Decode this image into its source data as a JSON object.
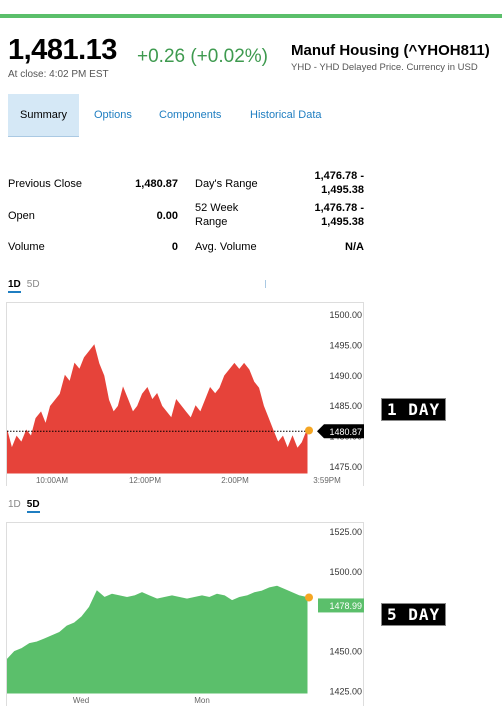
{
  "header": {
    "price": "1,481.13",
    "change": "+0.26 (+0.02%)",
    "close_time": "At close: 4:02 PM EST",
    "name": "Manuf Housing (^YHOH811)",
    "sub": "YHD - YHD Delayed Price. Currency in USD"
  },
  "tabs": [
    "Summary",
    "Options",
    "Components",
    "Historical Data"
  ],
  "stats": {
    "prev_close_label": "Previous Close",
    "prev_close_value": "1,480.87",
    "open_label": "Open",
    "open_value": "0.00",
    "volume_label": "Volume",
    "volume_value": "0",
    "days_range_label": "Day's Range",
    "days_range_value_1": "1,476.78 -",
    "days_range_value_2": "1,495.38",
    "week52_label_1": "52 Week",
    "week52_label_2": "Range",
    "week52_value_1": "1,476.78 -",
    "week52_value_2": "1,495.38",
    "avg_volume_label": "Avg. Volume",
    "avg_volume_value": "N/A"
  },
  "range_tabs_1": {
    "a": "1D",
    "b": "5D",
    "selected": "1D"
  },
  "range_tabs_2": {
    "a": "1D",
    "b": "5D",
    "selected": "5D"
  },
  "badges": {
    "one_day": "1 DAY",
    "five_day": "5 DAY"
  },
  "colors": {
    "accent": "#1f7ec1",
    "up": "#5bbf6b",
    "down": "#e6433a",
    "marker": "#f5a623"
  },
  "chart_data": [
    {
      "type": "area",
      "color": "#e6433a",
      "x_ticks": [
        "10:00AM",
        "12:00PM",
        "2:00PM",
        "3:59PM"
      ],
      "y_ticks": [
        "1500.00",
        "1495.00",
        "1490.00",
        "1485.00",
        "1480.00",
        "1475.00"
      ],
      "ylim": [
        1474,
        1501
      ],
      "reference_line": 1480.87,
      "reference_label": "1480.87",
      "values": [
        1481,
        1478,
        1480,
        1479,
        1481,
        1480,
        1483,
        1484,
        1482,
        1485,
        1486,
        1487,
        1490,
        1489,
        1492,
        1491,
        1493,
        1494,
        1495,
        1492,
        1490,
        1486,
        1484,
        1485,
        1488,
        1486,
        1484,
        1485,
        1487,
        1488,
        1486,
        1487,
        1485,
        1484,
        1483,
        1486,
        1485,
        1484,
        1483,
        1485,
        1484,
        1486,
        1488,
        1487,
        1488,
        1490,
        1491,
        1492,
        1491,
        1492,
        1491,
        1489,
        1488,
        1485,
        1483,
        1481,
        1479,
        1480,
        1478,
        1480,
        1478,
        1479,
        1481
      ]
    },
    {
      "type": "area",
      "color": "#5bbf6b",
      "x_ticks": [
        "Wed",
        "Mon"
      ],
      "y_ticks": [
        "1525.00",
        "1500.00",
        "1478.99",
        "1450.00",
        "1425.00"
      ],
      "ylim": [
        1424,
        1527
      ],
      "last_label": "1478.99",
      "values": [
        1445,
        1450,
        1452,
        1455,
        1456,
        1458,
        1460,
        1462,
        1466,
        1468,
        1472,
        1478,
        1488,
        1484,
        1486,
        1485,
        1484,
        1485,
        1487,
        1485,
        1483,
        1484,
        1485,
        1484,
        1483,
        1484,
        1485,
        1484,
        1486,
        1485,
        1482,
        1484,
        1485,
        1487,
        1488,
        1490,
        1491,
        1489,
        1487,
        1485,
        1484
      ]
    }
  ]
}
